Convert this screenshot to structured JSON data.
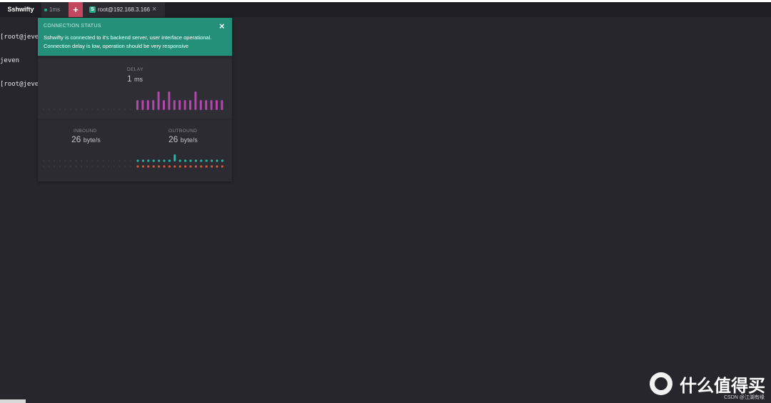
{
  "tabs": {
    "brand": "Sshwifty",
    "status": "1ms",
    "add": "+",
    "session_icon": "S",
    "session": "root@192.168.3.166",
    "close": "×"
  },
  "terminal": {
    "lines": [
      "[root@jeve",
      "jeven",
      "[root@jeve"
    ]
  },
  "panel": {
    "title": "CONNECTION STATUS",
    "close": "×",
    "message": "Sshwifty is connected to it's backend server, user interface operational.",
    "message2": "Connection delay is low, operation should be very responsive",
    "delay_label": "DELAY",
    "delay_value": "1",
    "delay_unit": "ms",
    "inbound_label": "INBOUND",
    "inbound_value": "26",
    "inbound_unit": "byte/s",
    "outbound_label": "OUTBOUND",
    "outbound_value": "26",
    "outbound_unit": "byte/s",
    "delay_history": [
      1,
      1,
      1,
      1,
      2,
      1,
      2,
      1,
      1,
      1,
      1,
      2,
      1,
      1,
      1,
      1,
      1
    ],
    "outbound_history": [
      1,
      1,
      1,
      1,
      1,
      1,
      1,
      2,
      1,
      1,
      1,
      1,
      1,
      1,
      1,
      1,
      1
    ]
  },
  "footer": {
    "brand": "什么值得买",
    "credit": "CSDN @江湖有缘"
  },
  "colors": {
    "background": "#27262d",
    "accent": "#24907a",
    "add_tab": "#c2485f",
    "delay_bar": "#b446b0",
    "inbound_dot": "#1fb8ab",
    "outbound_dot": "#d25a3c"
  }
}
